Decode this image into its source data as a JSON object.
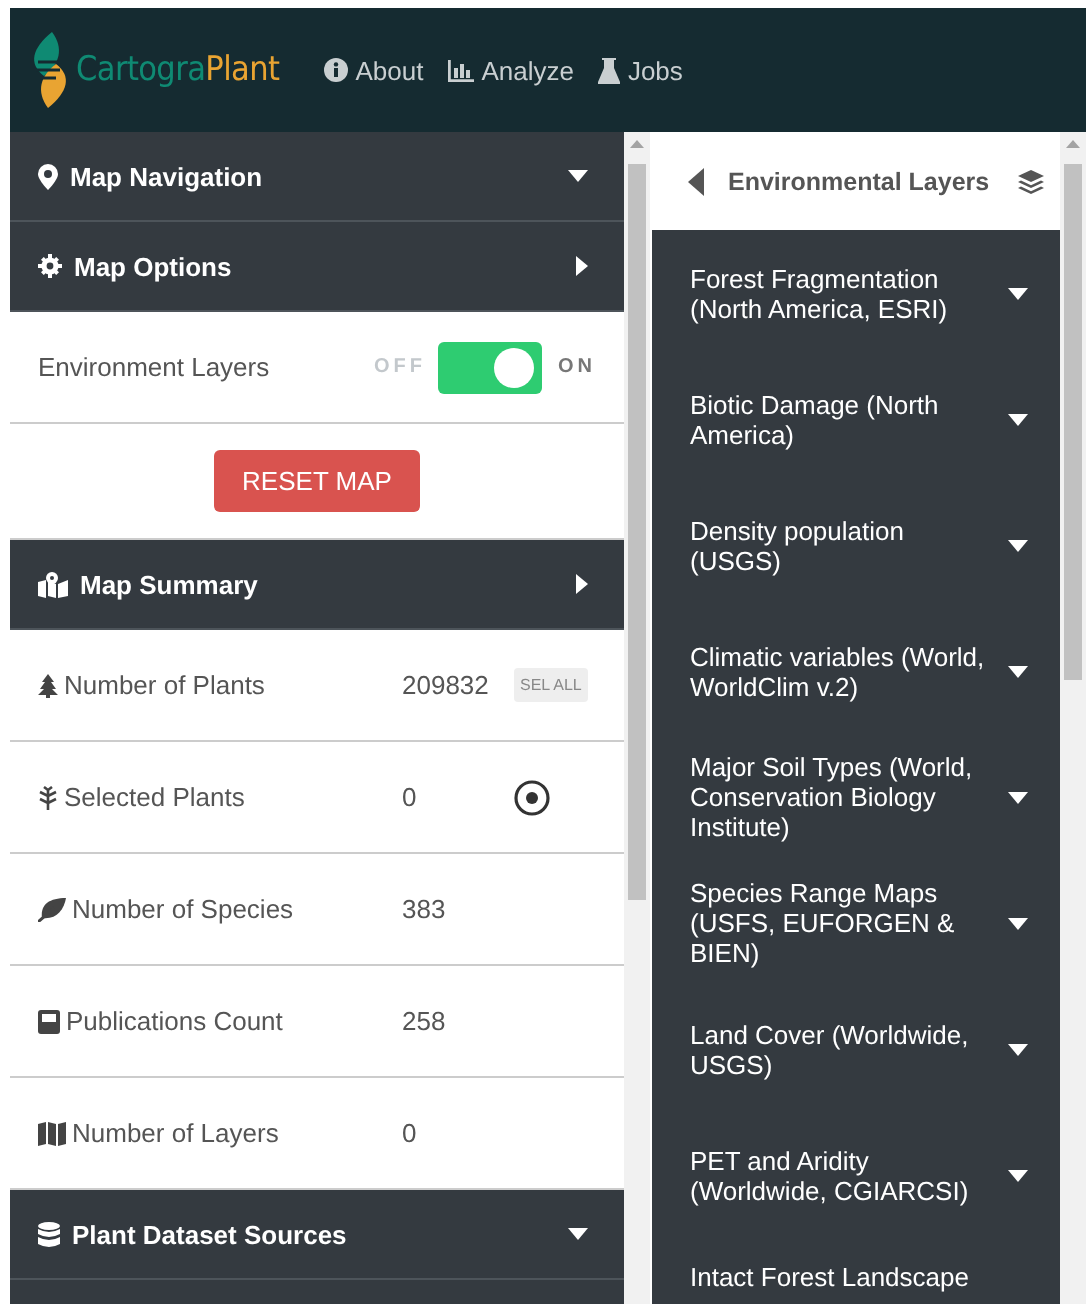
{
  "navbar": {
    "logo": {
      "part_1": "Cartogra",
      "part_2": "Plant"
    },
    "links": [
      {
        "label": "About"
      },
      {
        "label": "Analyze"
      },
      {
        "label": "Jobs"
      }
    ]
  },
  "sidebar": {
    "items": [
      {
        "kind": "header",
        "label": "Map Navigation",
        "expanded": true
      },
      {
        "kind": "header",
        "label": "Map Options",
        "expanded": false
      },
      {
        "kind": "toggle",
        "label": "Environment Layers",
        "off_label": "OFF",
        "on_label": "ON",
        "on": true
      },
      {
        "kind": "button",
        "label": "RESET MAP"
      },
      {
        "kind": "header",
        "label": "Map Summary",
        "expanded": false
      },
      {
        "kind": "stat",
        "label": "Number of Plants",
        "value": "209832",
        "action": "SEL ALL"
      },
      {
        "kind": "stat",
        "label": "Selected Plants",
        "value": "0",
        "target": true
      },
      {
        "kind": "stat",
        "label": "Number of Species",
        "value": "383"
      },
      {
        "kind": "stat",
        "label": "Publications Count",
        "value": "258"
      },
      {
        "kind": "stat",
        "label": "Number of Layers",
        "value": "0"
      },
      {
        "kind": "header",
        "label": "Plant Dataset Sources",
        "expanded": true
      }
    ]
  },
  "layers_panel": {
    "title": "Environmental Layers",
    "items": [
      {
        "label": "Forest Fragmentation (North America, ESRI)",
        "expanded": false
      },
      {
        "label": "Biotic Damage (North America)",
        "expanded": false
      },
      {
        "label": "Density population (USGS)",
        "expanded": false
      },
      {
        "label": "Climatic variables (World, WorldClim v.2)",
        "expanded": false
      },
      {
        "label": "Major Soil Types (World, Conservation Biology Institute)",
        "expanded": false
      },
      {
        "label": "Species Range Maps (USFS, EUFORGEN & BIEN)",
        "expanded": false
      },
      {
        "label": "Land Cover (Worldwide, USGS)",
        "expanded": false
      },
      {
        "label": "PET and Aridity (Worldwide, CGIARCSI)",
        "expanded": false
      },
      {
        "label": "Intact Forest Landscape"
      }
    ]
  }
}
